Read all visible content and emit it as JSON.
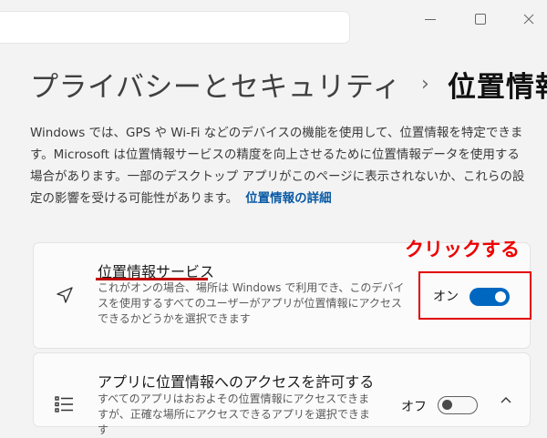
{
  "breadcrumb": {
    "parent": "プライバシーとセキュリティ",
    "separator": "›",
    "current": "位置情報"
  },
  "description": {
    "text": "Windows では、GPS や Wi-Fi などのデバイスの機能を使用して、位置情報を特定できます。Microsoft は位置情報サービスの精度を向上させるために位置情報データを使用する場合があります。一部のデスクトップ アプリがこのページに表示されないか、これらの設定の影響を受ける可能性があります。",
    "link": "位置情報の詳細"
  },
  "location_service": {
    "title": "位置情報サービス",
    "description": "これがオンの場合、場所は Windows で利用でき、このデバイスを使用するすべてのユーザーがアプリが位置情報にアクセスできるかどうかを選択できます",
    "toggle_label": "オン",
    "toggle_state": "on"
  },
  "app_access": {
    "title": "アプリに位置情報へのアクセスを許可する",
    "description": "すべてのアプリはおおよその位置情報にアクセスできますが、正確な場所にアクセスできるアプリを選択できます",
    "toggle_label": "オフ",
    "toggle_state": "off"
  },
  "annotation": {
    "text": "クリックする",
    "color": "#ee0000"
  },
  "colors": {
    "accent": "#0067c0",
    "link": "#0a5aa6",
    "highlight": "#e10000",
    "background": "#f3f3f3"
  }
}
